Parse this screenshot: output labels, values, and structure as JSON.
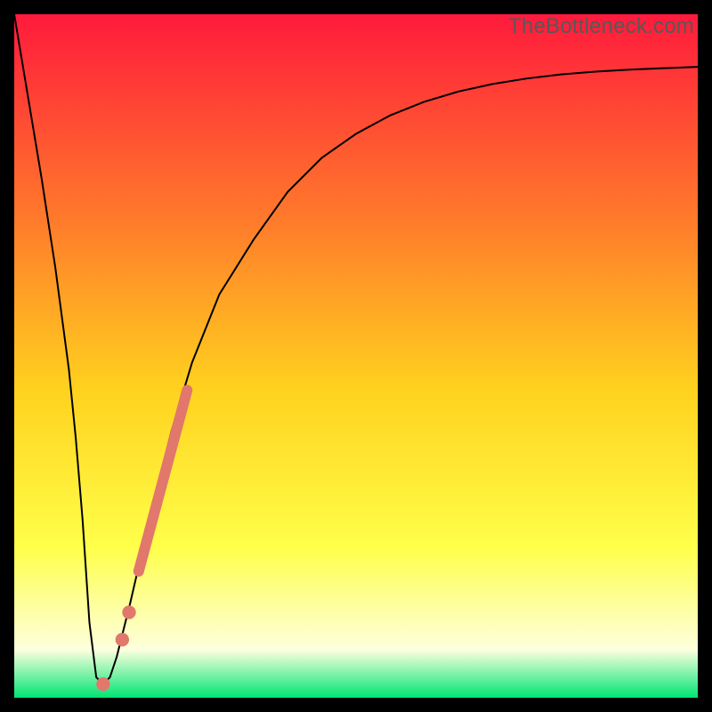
{
  "watermark": "TheBottleneck.com",
  "colors": {
    "frame": "#000000",
    "grad_top": "#ff1a3c",
    "grad_mid_upper": "#ff7a2b",
    "grad_mid": "#ffd21e",
    "grad_mid_lower": "#ffff4a",
    "grad_pale": "#fdffde",
    "grad_green": "#00e573",
    "curve": "#000000",
    "marker": "#e2776c"
  },
  "chart_data": {
    "type": "line",
    "title": "",
    "xlabel": "",
    "ylabel": "",
    "xlim": [
      0,
      100
    ],
    "ylim": [
      0,
      100
    ],
    "series": [
      {
        "name": "bottleneck-curve",
        "x": [
          0,
          2,
          4,
          6,
          8,
          9,
          10,
          11,
          12,
          13,
          14,
          15,
          17,
          20,
          23,
          26,
          30,
          35,
          40,
          45,
          50,
          55,
          60,
          65,
          70,
          75,
          80,
          85,
          90,
          95,
          100
        ],
        "values": [
          100,
          88,
          76,
          63,
          48,
          38,
          26,
          11,
          3,
          2,
          3,
          6,
          14,
          27,
          39,
          49,
          59,
          67,
          74,
          79,
          82.5,
          85.2,
          87.2,
          88.7,
          89.8,
          90.6,
          91.2,
          91.6,
          91.9,
          92.1,
          92.3
        ]
      }
    ],
    "markers": [
      {
        "name": "marker-min",
        "x": 13.0,
        "y": 2.0,
        "r": 1.0
      },
      {
        "name": "marker-dot-lower",
        "x": 15.8,
        "y": 8.5,
        "r": 1.0
      },
      {
        "name": "marker-dot-upper",
        "x": 16.8,
        "y": 12.5,
        "r": 1.0
      },
      {
        "name": "marker-bar-start",
        "x": 18.2,
        "y": 18.5,
        "r": 1.3
      },
      {
        "name": "marker-bar-end",
        "x": 25.3,
        "y": 45.0,
        "r": 1.3
      }
    ]
  }
}
